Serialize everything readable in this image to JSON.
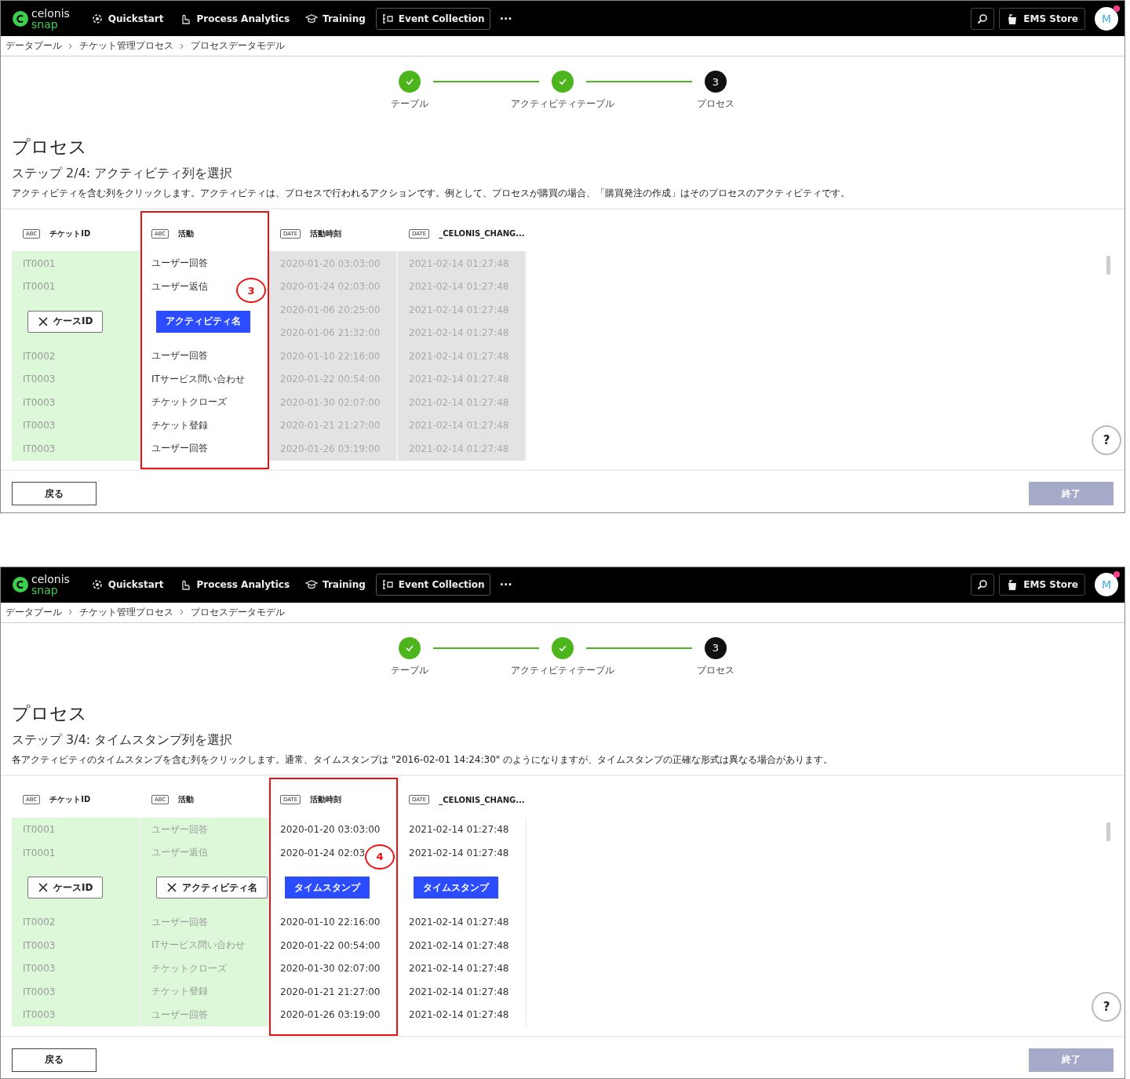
{
  "screens": [
    {
      "nav": {
        "logo_top": "celonis",
        "logo_bottom": "snap",
        "items": [
          {
            "label": "Quickstart",
            "selected": false
          },
          {
            "label": "Process Analytics",
            "selected": false
          },
          {
            "label": "Training",
            "selected": false
          },
          {
            "label": "Event Collection",
            "selected": true
          }
        ],
        "more": "···",
        "store": "EMS Store",
        "avatar": "M",
        "notification": true
      },
      "breadcrumb": [
        "データプール",
        "チケット管理プロセス",
        "プロセスデータモデル"
      ],
      "steps": [
        {
          "label": "テーブル",
          "completed": true
        },
        {
          "label": "アクティビティテーブル",
          "completed": true
        },
        {
          "label": "プロセス",
          "completed": false,
          "number": "3"
        }
      ],
      "title": "プロセス",
      "step_title": "ステップ 2/4: アクティビティ列を選択",
      "description": "アクティビティを含む列をクリックします。アクティビティは、プロセスで行われるアクションです。例として、プロセスが購買の場合、「購買発注の作成」はそのプロセスのアクティビティです。",
      "columns": [
        {
          "type": "ABC",
          "name": "チケットID",
          "assigned": true,
          "disabled": false,
          "highlighted": false,
          "upper": [
            "IT0001",
            "IT0001"
          ],
          "tag": {
            "label": "ケースID",
            "kind": "assigned"
          },
          "lower": [
            "IT0002",
            "IT0003",
            "IT0003",
            "IT0003",
            "IT0003"
          ]
        },
        {
          "type": "ABC",
          "name": "活動",
          "assigned": false,
          "disabled": false,
          "highlighted": true,
          "annotation": "3",
          "upper": [
            "ユーザー回答",
            "ユーザー返信"
          ],
          "tag": {
            "label": "アクティビティ名",
            "kind": "suggested"
          },
          "lower": [
            "ユーザー回答",
            "ITサービス問い合わせ",
            "チケットクローズ",
            "チケット登録",
            "ユーザー回答"
          ]
        },
        {
          "type": "DATE",
          "name": "活動時刻",
          "assigned": false,
          "disabled": true,
          "highlighted": false,
          "upper": [
            "2020-01-20 03:03:00",
            "2020-01-24 02:03:00",
            "2020-01-06 20:25:00",
            "2020-01-06 21:32:00"
          ],
          "lower": [
            "2020-01-10 22:16:00",
            "2020-01-22 00:54:00",
            "2020-01-30 02:07:00",
            "2020-01-21 21:27:00",
            "2020-01-26 03:19:00"
          ]
        },
        {
          "type": "DATE",
          "name": "_CELONIS_CHANG...",
          "assigned": false,
          "disabled": true,
          "highlighted": false,
          "upper": [
            "2021-02-14 01:27:48",
            "2021-02-14 01:27:48",
            "2021-02-14 01:27:48",
            "2021-02-14 01:27:48"
          ],
          "lower": [
            "2021-02-14 01:27:48",
            "2021-02-14 01:27:48",
            "2021-02-14 01:27:48",
            "2021-02-14 01:27:48",
            "2021-02-14 01:27:48"
          ]
        }
      ],
      "help": "?",
      "back": "戻る",
      "finish": {
        "label": "終了",
        "disabled": true
      }
    },
    {
      "nav": {
        "logo_top": "celonis",
        "logo_bottom": "snap",
        "items": [
          {
            "label": "Quickstart",
            "selected": false
          },
          {
            "label": "Process Analytics",
            "selected": false
          },
          {
            "label": "Training",
            "selected": false
          },
          {
            "label": "Event Collection",
            "selected": true
          }
        ],
        "more": "···",
        "store": "EMS Store",
        "avatar": "M",
        "notification": true
      },
      "breadcrumb": [
        "データプール",
        "チケット管理プロセス",
        "プロセスデータモデル"
      ],
      "steps": [
        {
          "label": "テーブル",
          "completed": true
        },
        {
          "label": "アクティビティテーブル",
          "completed": true
        },
        {
          "label": "プロセス",
          "completed": false,
          "number": "3"
        }
      ],
      "title": "プロセス",
      "step_title": "ステップ 3/4: タイムスタンプ列を選択",
      "description": "各アクティビティのタイムスタンプを含む列をクリックします。通常、タイムスタンプは \"2016-02-01 14:24:30\" のようになりますが、タイムスタンプの正確な形式は異なる場合があります。",
      "columns": [
        {
          "type": "ABC",
          "name": "チケットID",
          "assigned": true,
          "disabled": false,
          "highlighted": false,
          "upper": [
            "IT0001",
            "IT0001"
          ],
          "tag": {
            "label": "ケースID",
            "kind": "assigned"
          },
          "lower": [
            "IT0002",
            "IT0003",
            "IT0003",
            "IT0003",
            "IT0003"
          ]
        },
        {
          "type": "ABC",
          "name": "活動",
          "assigned": true,
          "disabled": false,
          "highlighted": false,
          "upper": [
            "ユーザー回答",
            "ユーザー返信"
          ],
          "tag": {
            "label": "アクティビティ名",
            "kind": "assigned"
          },
          "lower": [
            "ユーザー回答",
            "ITサービス問い合わせ",
            "チケットクローズ",
            "チケット登録",
            "ユーザー回答"
          ]
        },
        {
          "type": "DATE",
          "name": "活動時刻",
          "assigned": false,
          "disabled": false,
          "highlighted": true,
          "annotation": "4",
          "upper": [
            "2020-01-20 03:03:00",
            "2020-01-24 02:03"
          ],
          "tag": {
            "label": "タイムスタンプ",
            "kind": "suggested"
          },
          "lower": [
            "2020-01-10 22:16:00",
            "2020-01-22 00:54:00",
            "2020-01-30 02:07:00",
            "2020-01-21 21:27:00",
            "2020-01-26 03:19:00"
          ]
        },
        {
          "type": "DATE",
          "name": "_CELONIS_CHANG...",
          "assigned": false,
          "disabled": false,
          "highlighted": false,
          "upper": [
            "2021-02-14 01:27:48",
            "2021-02-14 01:27:48"
          ],
          "tag": {
            "label": "タイムスタンプ",
            "kind": "suggested"
          },
          "lower": [
            "2021-02-14 01:27:48",
            "2021-02-14 01:27:48",
            "2021-02-14 01:27:48",
            "2021-02-14 01:27:48",
            "2021-02-14 01:27:48"
          ]
        }
      ],
      "help": "?",
      "back": "戻る",
      "finish": {
        "label": "終了",
        "disabled": true
      }
    }
  ]
}
